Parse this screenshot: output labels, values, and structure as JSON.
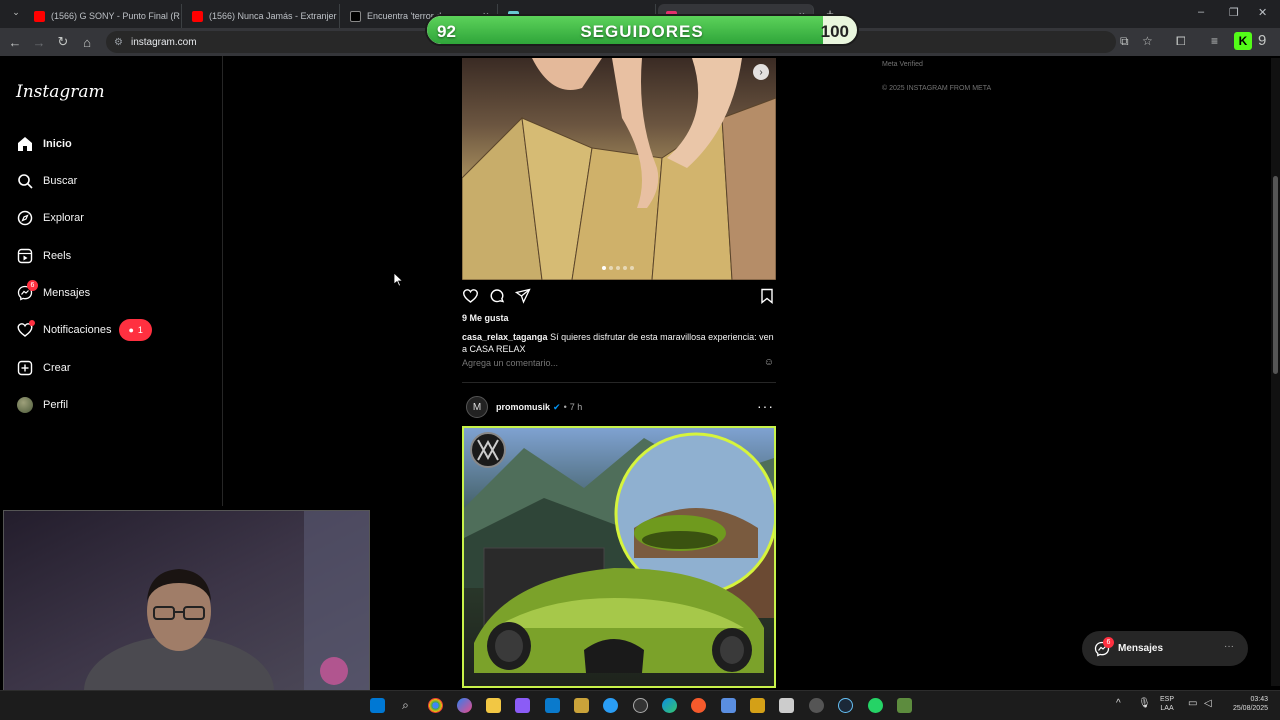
{
  "browser": {
    "tabs": [
      {
        "title": "(1566) G SONY - Punto Final (R",
        "color": "#ff0000"
      },
      {
        "title": "(1566) Nunca Jamás - Extranjer",
        "color": "#ff0000"
      },
      {
        "title": "Encuentra 'terror de",
        "color": "#000000"
      },
      {
        "title": "",
        "color": "#69c9d0"
      },
      {
        "title": "",
        "color": "#e1306c"
      }
    ],
    "url": "instagram.com"
  },
  "followers_overlay": {
    "current": "92",
    "label": "SEGUIDORES",
    "goal": "100",
    "progress": 0.92
  },
  "sidebar": {
    "logo": "Instagram",
    "items": [
      {
        "label": "Inicio",
        "icon": "home-icon",
        "active": true
      },
      {
        "label": "Buscar",
        "icon": "search-icon"
      },
      {
        "label": "Explorar",
        "icon": "compass-icon"
      },
      {
        "label": "Reels",
        "icon": "reels-icon"
      },
      {
        "label": "Mensajes",
        "icon": "messenger-icon",
        "badge": "6"
      },
      {
        "label": "Notificaciones",
        "icon": "heart-icon",
        "pill": "1"
      },
      {
        "label": "Crear",
        "icon": "plus-square-icon"
      },
      {
        "label": "Perfil",
        "icon": "avatar"
      }
    ]
  },
  "post1": {
    "likes": "9 Me gusta",
    "username": "casa_relax_taganga",
    "caption": "Sí quieres disfrutar de esta maravillosa experiencia: ven a CASA RELAX",
    "comment_placeholder": "Agrega un comentario..."
  },
  "post2": {
    "username": "promomusik",
    "time": "7 h"
  },
  "footer": {
    "meta_verified": "Meta Verified",
    "copyright": "© 2025 INSTAGRAM FROM META"
  },
  "floating_messages": {
    "label": "Mensajes",
    "badge": "6"
  },
  "taskbar": {
    "lang_1": "ESP",
    "lang_2": "LAA",
    "time": "03:43",
    "date": "25/08/2025"
  }
}
